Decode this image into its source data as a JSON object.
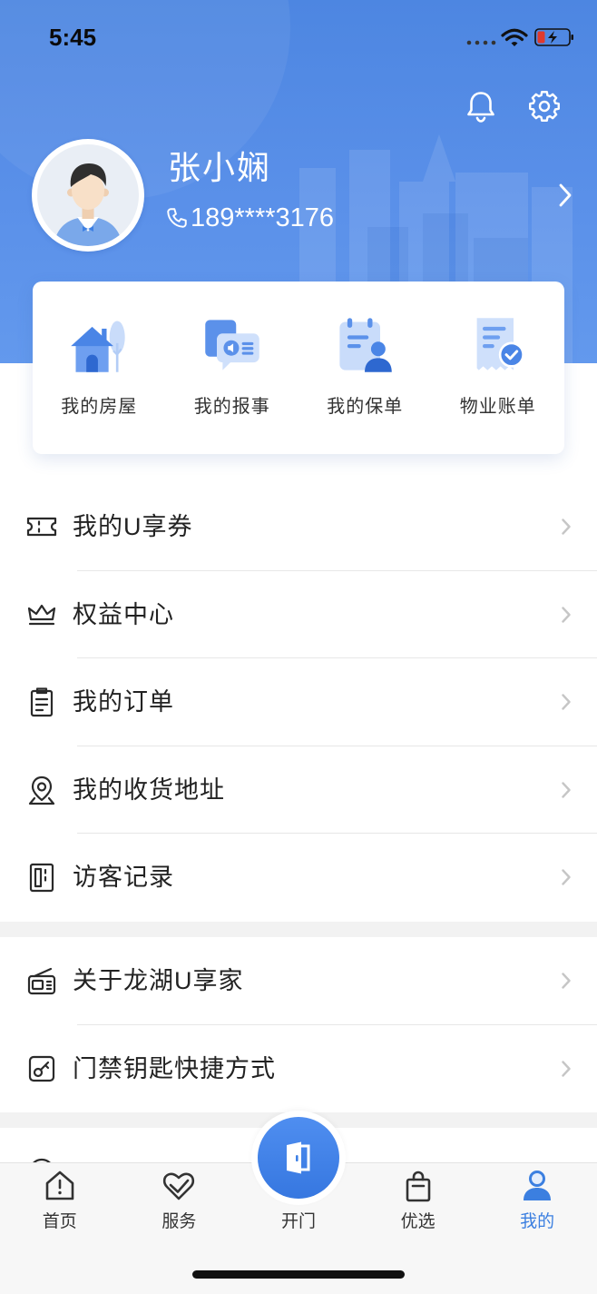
{
  "status_bar": {
    "time": "5:45",
    "wifi_icon": "wifi-icon",
    "battery_icon": "battery-charging-icon"
  },
  "header": {
    "bell_icon": "bell-icon",
    "settings_icon": "gear-icon"
  },
  "profile": {
    "name": "张小娴",
    "phone": "189****3176",
    "avatar_icon": "avatar-icon",
    "phone_icon": "phone-icon"
  },
  "quick_actions": [
    {
      "label": "我的房屋",
      "icon": "house-icon"
    },
    {
      "label": "我的报事",
      "icon": "report-icon"
    },
    {
      "label": "我的保单",
      "icon": "policy-icon"
    },
    {
      "label": "物业账单",
      "icon": "bill-icon"
    }
  ],
  "menu_sections": [
    {
      "items": [
        {
          "label": "我的U享券",
          "icon": "coupon-icon"
        },
        {
          "label": "权益中心",
          "icon": "crown-icon"
        },
        {
          "label": "我的订单",
          "icon": "order-icon"
        },
        {
          "label": "我的收货地址",
          "icon": "location-icon"
        },
        {
          "label": "访客记录",
          "icon": "visitor-record-icon"
        }
      ]
    },
    {
      "items": [
        {
          "label": "关于龙湖U享家",
          "icon": "about-icon"
        },
        {
          "label": "门禁钥匙快捷方式",
          "icon": "door-key-icon"
        }
      ]
    }
  ],
  "tab_bar": {
    "tabs": [
      {
        "label": "首页",
        "icon": "home-icon"
      },
      {
        "label": "服务",
        "icon": "service-icon"
      },
      {
        "label": "开门",
        "icon": "door-icon"
      },
      {
        "label": "优选",
        "icon": "shopping-bag-icon"
      },
      {
        "label": "我的",
        "icon": "profile-icon"
      }
    ],
    "active_index": 4
  },
  "colors": {
    "primary": "#3b7fe0",
    "header_blue": "#5a90e9",
    "battery_low": "#e03a2e",
    "chevron": "#c6c6c6"
  }
}
